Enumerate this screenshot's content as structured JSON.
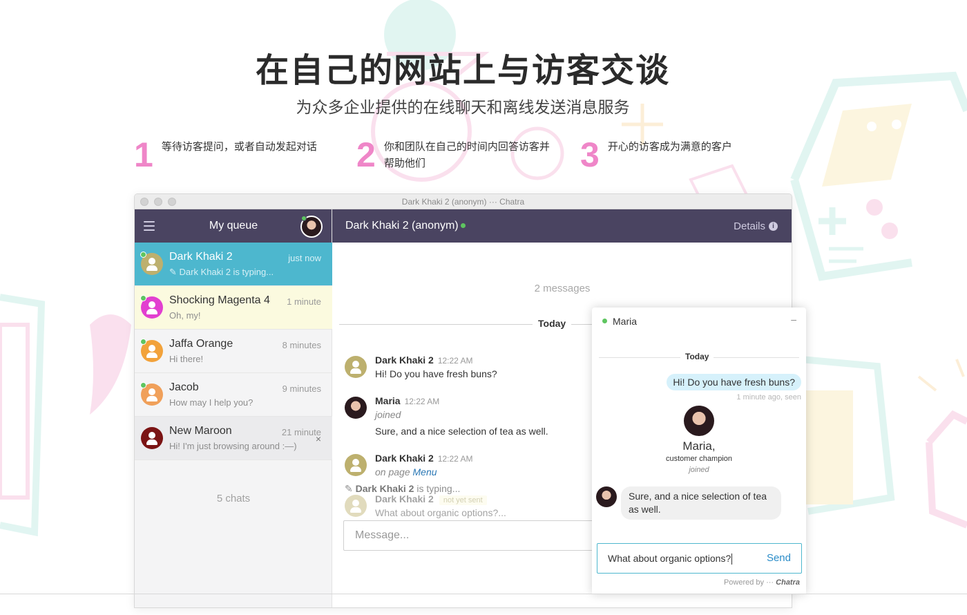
{
  "hero": {
    "title": "在自己的网站上与访客交谈",
    "subtitle": "为众多企业提供的在线聊天和离线发送消息服务"
  },
  "steps": [
    {
      "num": "1",
      "text": "等待访客提问，或者自动发起对话"
    },
    {
      "num": "2",
      "text_line1": "你和团队在自己的时间内回答访客并",
      "text_line2": "帮助他们"
    },
    {
      "num": "3",
      "text": "开心的访客成为满意的客户"
    }
  ],
  "window": {
    "title": "Dark Khaki 2 (anonym) ··· Chatra"
  },
  "sidebar": {
    "title": "My queue",
    "chats": [
      {
        "name": "Dark Khaki 2",
        "time": "just now",
        "preview": "✎ Dark Khaki 2 is typing...",
        "avatar_color": "#bdb06e",
        "online": true,
        "state": "active"
      },
      {
        "name": "Shocking Magenta 4",
        "time": "1 minute",
        "preview": "Oh, my!",
        "avatar_color": "#e23fd0",
        "online": true,
        "state": "yellow"
      },
      {
        "name": "Jaffa Orange",
        "time": "8 minutes",
        "preview": "Hi there!",
        "avatar_color": "#f2a23b",
        "online": true,
        "state": "normal"
      },
      {
        "name": "Jacob",
        "time": "9 minutes",
        "preview": "How may I help you?",
        "avatar_color": "#f0a05a",
        "online": true,
        "state": "normal"
      },
      {
        "name": "New Maroon",
        "time": "21 minute",
        "preview": "Hi! I'm just browsing around :—)",
        "avatar_color": "#7b1414",
        "online": false,
        "state": "gray",
        "close": "×"
      }
    ],
    "count_label": "5 chats"
  },
  "conversation": {
    "title": "Dark Khaki 2 (anonym)",
    "details_label": "Details",
    "info_glyph": "i",
    "message_count": "2 messages",
    "today_label": "Today",
    "messages": [
      {
        "author": "Dark Khaki 2",
        "time": "12:22 AM",
        "text": "Hi! Do you have fresh buns?"
      },
      {
        "author": "Maria",
        "time": "12:22 AM",
        "note": "joined",
        "text": "Sure, and a nice selection of tea as well."
      },
      {
        "author": "Dark Khaki 2",
        "time": "12:22 AM",
        "note_prefix": "on page",
        "link": "Menu"
      },
      {
        "author": "Dark Khaki 2",
        "status": "not yet sent",
        "text": "What about organic options?..."
      }
    ],
    "typing_name": "Dark Khaki 2",
    "typing_suffix": "is typing...",
    "composer_placeholder": "Message..."
  },
  "widget": {
    "agent_name": "Maria",
    "minimize": "–",
    "today_label": "Today",
    "visitor_message": "Hi! Do you have fresh buns?",
    "visitor_meta": "1 minute ago, seen",
    "agent_display_name": "Maria,",
    "agent_role": "customer champion",
    "agent_joined": "joined",
    "agent_message": "Sure, and a nice selection of tea as well.",
    "input_value": "What about organic options?",
    "send_label": "Send",
    "powered_prefix": "Powered by ···",
    "powered_brand": "Chatra"
  },
  "colors": {
    "header": "#4a4461",
    "active": "#4db7ce",
    "accent_pink": "#ef86c8",
    "online": "#5ec560"
  }
}
